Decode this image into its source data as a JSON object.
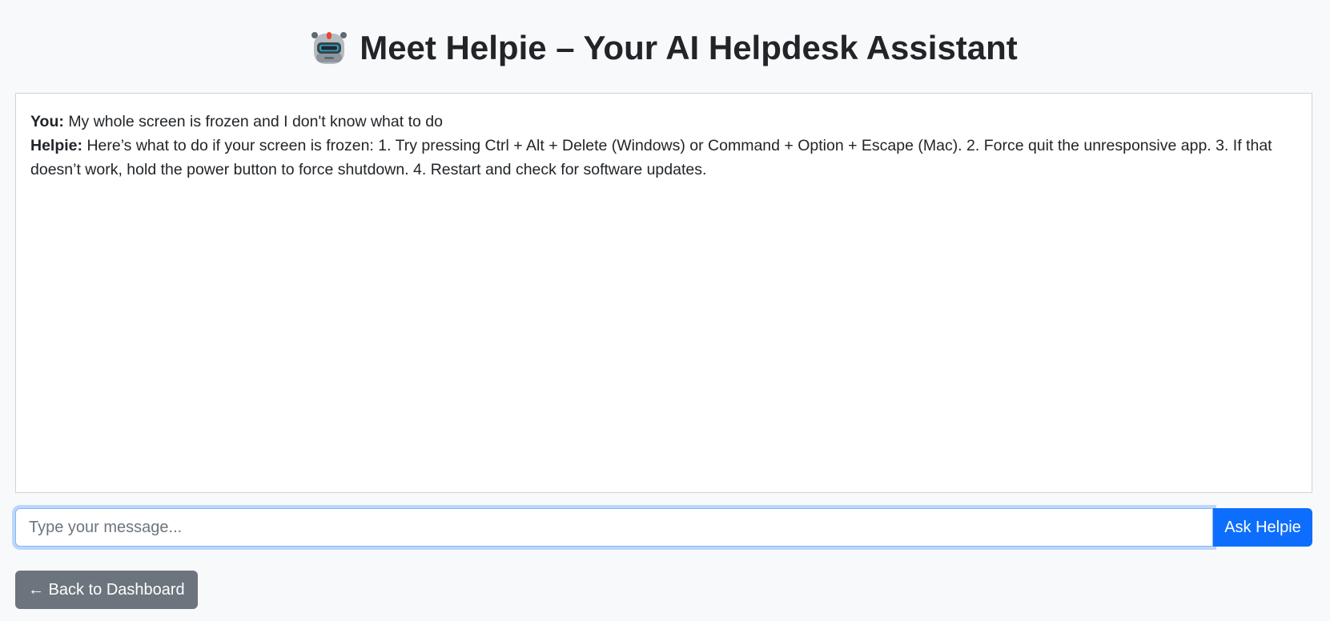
{
  "header": {
    "title": "Meet Helpie – Your AI Helpdesk Assistant",
    "icon": "robot-icon"
  },
  "chat": {
    "messages": [
      {
        "speaker": "You:",
        "text": "My whole screen is frozen and I don't know what to do"
      },
      {
        "speaker": "Helpie:",
        "text": "Here’s what to do if your screen is frozen: 1. Try pressing Ctrl + Alt + Delete (Windows) or Command + Option + Escape (Mac). 2. Force quit the unresponsive app. 3. If that doesn’t work, hold the power button to force shutdown. 4. Restart and check for software updates."
      }
    ]
  },
  "composer": {
    "placeholder": "Type your message...",
    "value": "",
    "ask_label": "Ask Helpie"
  },
  "nav": {
    "back_label": "← Back to Dashboard"
  },
  "colors": {
    "primary": "#0d6efd",
    "secondary": "#6c757d",
    "background": "#f8f9fa"
  }
}
